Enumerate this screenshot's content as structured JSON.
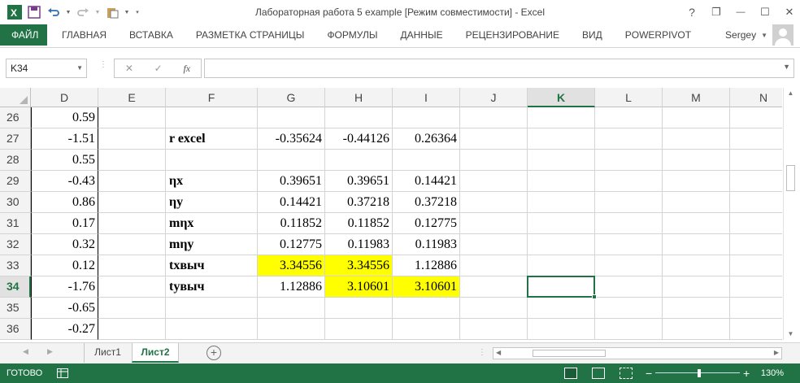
{
  "window": {
    "title": "Лабораторная работа 5 example  [Режим совместимости] - Excel",
    "help": "?",
    "restore": "❐",
    "minimize": "—",
    "maximize": "☐",
    "close": "✕"
  },
  "colors": {
    "accent": "#217346",
    "highlight": "#ffff00"
  },
  "ribbon": {
    "file": "ФАЙЛ",
    "tabs": [
      "ГЛАВНАЯ",
      "ВСТАВКА",
      "РАЗМЕТКА СТРАНИЦЫ",
      "ФОРМУЛЫ",
      "ДАННЫЕ",
      "РЕЦЕНЗИРОВАНИЕ",
      "ВИД",
      "POWERPIVOT"
    ],
    "user": "Sergey"
  },
  "formula_bar": {
    "name_box": "K34",
    "fx": "fx",
    "cancel": "✕",
    "confirm": "✓",
    "value": ""
  },
  "grid": {
    "columns": [
      "D",
      "E",
      "F",
      "G",
      "H",
      "I",
      "J",
      "K",
      "L",
      "M",
      "N"
    ],
    "active_column": "K",
    "active_row": "34",
    "rows": [
      {
        "row": "26",
        "D": "0.59",
        "F": "",
        "G": "",
        "H": "",
        "I": ""
      },
      {
        "row": "27",
        "D": "-1.51",
        "F": "r excel",
        "G": "-0.35624",
        "H": "-0.44126",
        "I": "0.26364"
      },
      {
        "row": "28",
        "D": "0.55",
        "F": "",
        "G": "",
        "H": "",
        "I": ""
      },
      {
        "row": "29",
        "D": "-0.43",
        "F": "ηx",
        "G": "0.39651",
        "H": "0.39651",
        "I": "0.14421"
      },
      {
        "row": "30",
        "D": "0.86",
        "F": "ηy",
        "G": "0.14421",
        "H": "0.37218",
        "I": "0.37218"
      },
      {
        "row": "31",
        "D": "0.17",
        "F": "mηx",
        "G": "0.11852",
        "H": "0.11852",
        "I": "0.12775"
      },
      {
        "row": "32",
        "D": "0.32",
        "F": "mηy",
        "G": "0.12775",
        "H": "0.11983",
        "I": "0.11983"
      },
      {
        "row": "33",
        "D": "0.12",
        "F": "tхвыч",
        "G": "3.34556",
        "H": "3.34556",
        "I": "1.12886"
      },
      {
        "row": "34",
        "D": "-1.76",
        "F": "tyвыч",
        "G": "1.12886",
        "H": "3.10601",
        "I": "3.10601"
      },
      {
        "row": "35",
        "D": "-0.65",
        "F": "",
        "G": "",
        "H": "",
        "I": ""
      },
      {
        "row": "36",
        "D": "-0.27",
        "F": "",
        "G": "",
        "H": "",
        "I": ""
      }
    ],
    "highlighted": [
      "G33",
      "H33",
      "H34",
      "I34"
    ]
  },
  "sheets": {
    "tabs": [
      "Лист1",
      "Лист2"
    ],
    "active": "Лист2",
    "add": "+"
  },
  "status": {
    "text": "ГОТОВО",
    "zoom": "130%",
    "zoom_minus": "−",
    "zoom_plus": "+"
  }
}
